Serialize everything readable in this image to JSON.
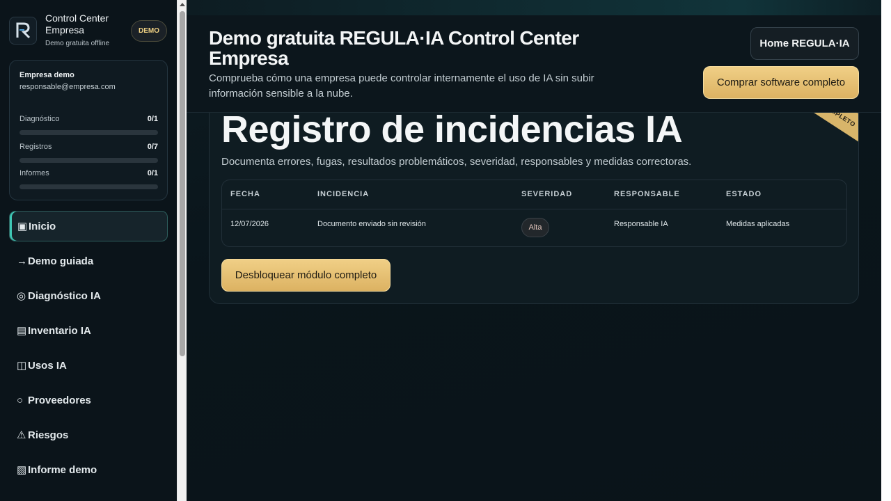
{
  "sidebar": {
    "brand_title": "Control Center Empresa",
    "brand_subtitle": "Demo gratuita offline",
    "demo_badge": "DEMO",
    "company": "Empresa demo",
    "email": "responsable@empresa.com",
    "progress": [
      {
        "label": "Diagnóstico",
        "count": "0/1",
        "fraction": 0
      },
      {
        "label": "Registros",
        "count": "0/7",
        "fraction": 0
      },
      {
        "label": "Informes",
        "count": "0/1",
        "fraction": 0
      }
    ],
    "nav": [
      {
        "icon": "▣",
        "label": "Inicio",
        "active": true
      },
      {
        "icon": "→",
        "label": "Demo guiada"
      },
      {
        "icon": "◎",
        "label": "Diagnóstico IA"
      },
      {
        "icon": "▤",
        "label": "Inventario IA"
      },
      {
        "icon": "◫",
        "label": "Usos IA"
      },
      {
        "icon": "○",
        "label": "Proveedores"
      },
      {
        "icon": "⚠",
        "label": "Riesgos"
      },
      {
        "icon": "▧",
        "label": "Informe demo"
      }
    ]
  },
  "header": {
    "title": "Demo gratuita REGULA·IA Control Center Empresa",
    "description": "Comprueba cómo una empresa puede controlar internamente el uso de IA sin subir información sensible a la nube.",
    "home_button": "Home REGULA·IA",
    "buy_button": "Comprar software completo"
  },
  "panel": {
    "ribbon": "COMPLETO",
    "title": "Registro de incidencias IA",
    "description": "Documenta errores, fugas, resultados problemáticos, severidad, responsables y medidas correctoras.",
    "table": {
      "headers": [
        "FECHA",
        "INCIDENCIA",
        "SEVERIDAD",
        "RESPONSABLE",
        "ESTADO"
      ],
      "rows": [
        [
          "12/07/2026",
          "Documento enviado sin revisión",
          "Alta",
          "Responsable IA",
          "Medidas aplicadas"
        ]
      ]
    },
    "unlock_button": "Desbloquear módulo completo"
  },
  "colors": {
    "accent_gold": "#d8b56a",
    "accent_teal": "#3fc7b5",
    "background": "#0a151b"
  }
}
